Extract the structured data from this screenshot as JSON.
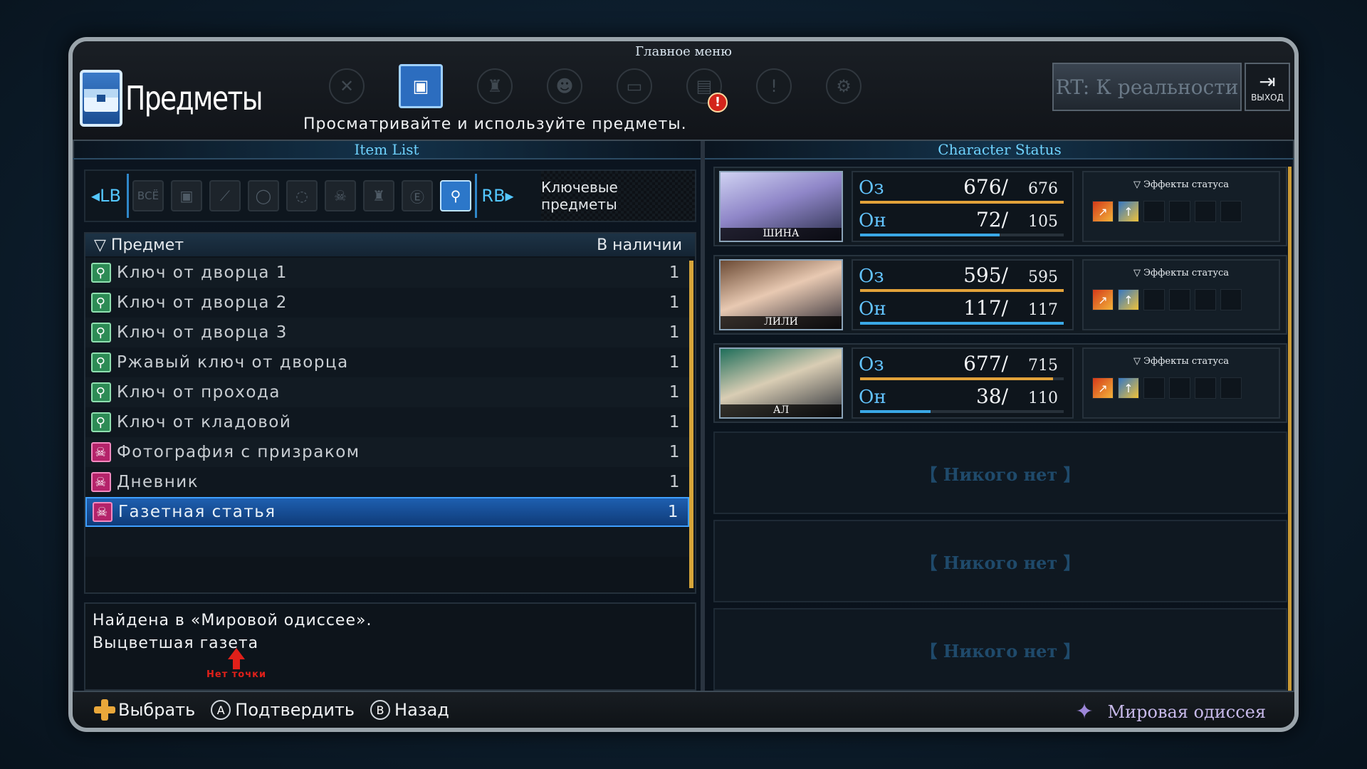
{
  "header": {
    "main_menu": "Главное меню",
    "title": "Предметы",
    "subtitle": "Просматривайте и используйте предметы.",
    "rt_button": "RT: К реальности",
    "exit_label": "ВЫХОД",
    "menu_icons": [
      "skills-icon",
      "items-icon",
      "equipment-icon",
      "party-icon",
      "system-icon",
      "book-icon",
      "info-icon",
      "settings-icon"
    ],
    "alert_mark": "!"
  },
  "item_list": {
    "panel_title": "Item List",
    "lb": "◂LB",
    "rb": "RB▸",
    "all_tab": "ВСЁ",
    "category_label": "Ключевые предметы",
    "col_item": "Предмет",
    "col_qty": "В наличии",
    "items": [
      {
        "icon": "key-icon",
        "name": "Ключ от дворца 1",
        "qty": "1"
      },
      {
        "icon": "key-icon",
        "name": "Ключ от дворца 2",
        "qty": "1"
      },
      {
        "icon": "key-icon",
        "name": "Ключ от дворца 3",
        "qty": "1"
      },
      {
        "icon": "key-icon",
        "name": "Ржавый ключ от дворца",
        "qty": "1"
      },
      {
        "icon": "key-icon",
        "name": "Ключ от прохода",
        "qty": "1"
      },
      {
        "icon": "key-icon",
        "name": "Ключ от кладовой",
        "qty": "1"
      },
      {
        "icon": "ghost-icon",
        "name": "Фотография с призраком",
        "qty": "1"
      },
      {
        "icon": "ghost-icon",
        "name": "Дневник",
        "qty": "1"
      },
      {
        "icon": "ghost-icon",
        "name": "Газетная статья",
        "qty": "1"
      }
    ],
    "description_line1": "Найдена в «Мировой одиссее».",
    "description_line2": "Выцветшая газета",
    "annotation": "Нет точки"
  },
  "character_status": {
    "panel_title": "Character Status",
    "hp_label": "Оз",
    "mp_label": "Он",
    "effects_title": "▽ Эффекты статуса",
    "characters": [
      {
        "name": "ШИНА",
        "hp": "676/",
        "hp_max": "676",
        "hp_frac": 1.0,
        "mp": "72/",
        "mp_max": "105",
        "mp_frac": 0.686
      },
      {
        "name": "ЛИЛИ",
        "hp": "595/",
        "hp_max": "595",
        "hp_frac": 1.0,
        "mp": "117/",
        "mp_max": "117",
        "mp_frac": 1.0
      },
      {
        "name": "АЛ",
        "hp": "677/",
        "hp_max": "715",
        "hp_frac": 0.947,
        "mp": "38/",
        "mp_max": "110",
        "mp_frac": 0.345
      }
    ],
    "empty_slot": "【 Никого нет 】"
  },
  "footer": {
    "select": "Выбрать",
    "confirm_btn": "A",
    "confirm": "Подтвердить",
    "back_btn": "B",
    "back": "Назад",
    "world": "Мировая одиссея"
  },
  "colors": {
    "accent": "#2c77c9",
    "hp_bar": "#e2a23a",
    "mp_bar": "#3aa8e6",
    "annotation": "#e0201a"
  }
}
